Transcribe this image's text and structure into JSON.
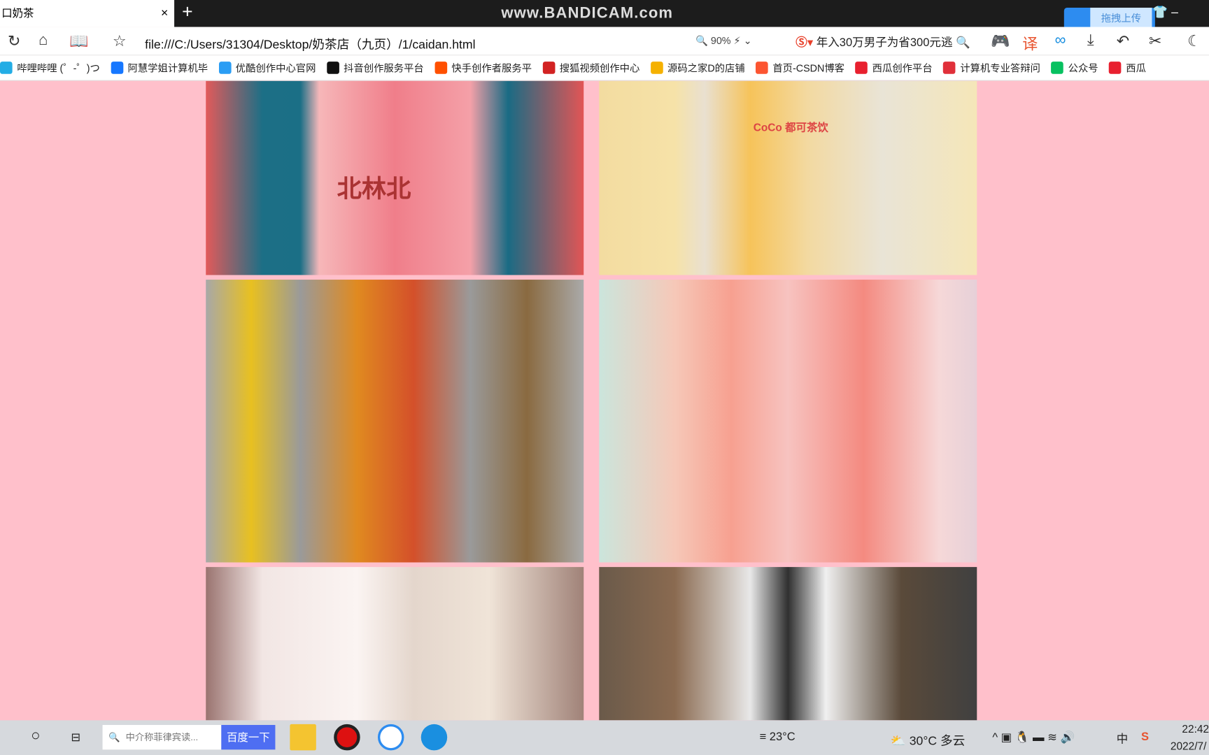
{
  "tab": {
    "title": "口奶茶",
    "close": "×",
    "new_tab": "+"
  },
  "watermark": "www.BANDICAM.com",
  "upload_button": "拖拽上传",
  "address": {
    "url": "file:///C:/Users/31304/Desktop/奶茶店（九页）/1/caidan.html",
    "zoom": "90%",
    "search_text": "年入30万男子为省300元逃"
  },
  "bookmarks": [
    {
      "label": "哔哩哔哩 (゜-゜)つ",
      "color": "#23ade5"
    },
    {
      "label": "阿慧学姐计算机毕",
      "color": "#1677ff"
    },
    {
      "label": "优酷创作中心官网",
      "color": "#2a9df4"
    },
    {
      "label": "抖音创作服务平台",
      "color": "#111111"
    },
    {
      "label": "快手创作者服务平",
      "color": "#ff5000"
    },
    {
      "label": "搜狐视频创作中心",
      "color": "#d22222"
    },
    {
      "label": "源码之家D的店铺",
      "color": "#f5b100"
    },
    {
      "label": "首页-CSDN博客",
      "color": "#fc5531"
    },
    {
      "label": "西瓜创作平台",
      "color": "#e8202f"
    },
    {
      "label": "计算机专业答辩问",
      "color": "#e0303a"
    },
    {
      "label": "公众号",
      "color": "#07c160"
    },
    {
      "label": "西瓜",
      "color": "#e8202f"
    }
  ],
  "content": {
    "background": "#ffc0cb",
    "images": [
      {
        "name": "watermelon-drink-image",
        "brand": "北林北"
      },
      {
        "name": "coco-milk-tea-image",
        "brand": "CoCo 都可茶饮"
      },
      {
        "name": "fruit-tea-image"
      },
      {
        "name": "peach-drink-image"
      },
      {
        "name": "milk-tea-cups-image"
      },
      {
        "name": "oreo-dessert-image"
      }
    ]
  },
  "taskbar": {
    "search_placeholder": "中介称菲律宾读...",
    "search_button": "百度一下",
    "weather1": "23°C",
    "weather2": "30°C 多云",
    "ime": "中",
    "time": "22:42",
    "date": "2022/7/"
  }
}
